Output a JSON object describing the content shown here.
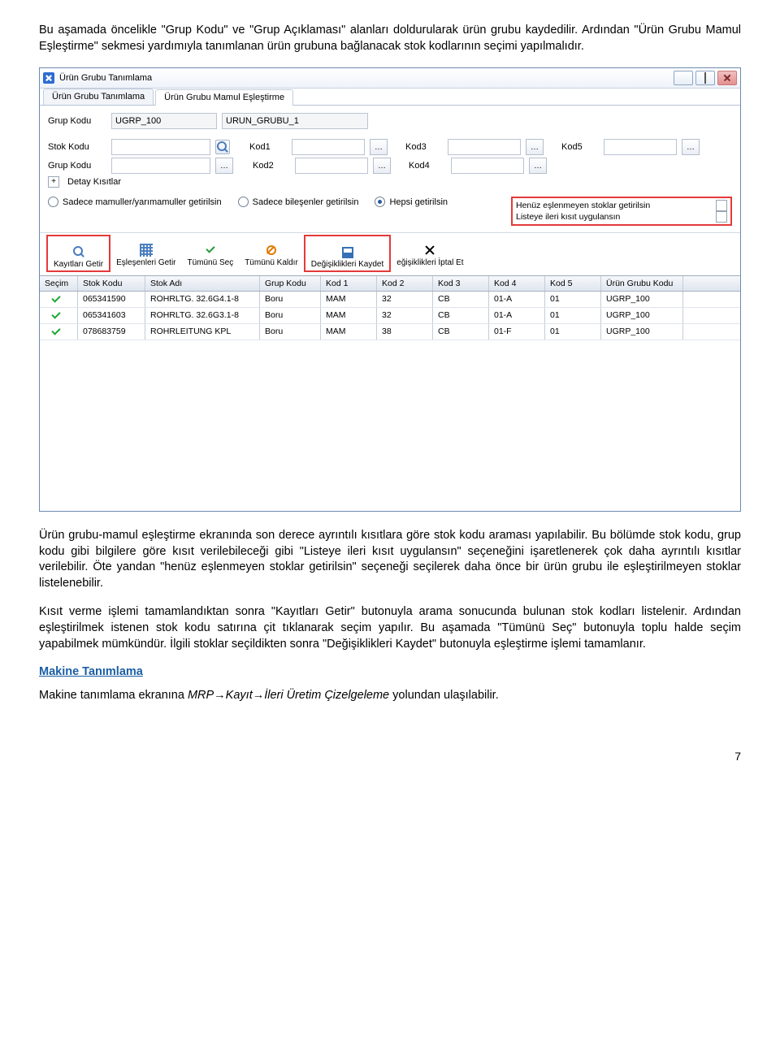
{
  "intro_paragraph": "Bu aşamada öncelikle \"Grup Kodu\" ve \"Grup Açıklaması\" alanları doldurularak ürün grubu kaydedilir. Ardından \"Ürün Grubu Mamul Eşleştirme\" sekmesi yardımıyla tanımlanan ürün grubuna bağlanacak stok kodlarının seçimi yapılmalıdır.",
  "window": {
    "title": "Ürün Grubu Tanımlama",
    "tabs": [
      "Ürün Grubu Tanımlama",
      "Ürün Grubu Mamul Eşleştirme"
    ],
    "fields": {
      "grup_kodu_label": "Grup Kodu",
      "grup_kodu_val": "UGRP_100",
      "grup_kodu_val2": "URUN_GRUBU_1",
      "stok_kodu_label": "Stok Kodu",
      "grup_kodu2_label": "Grup Kodu",
      "kod1": "Kod1",
      "kod2": "Kod2",
      "kod3": "Kod3",
      "kod4": "Kod4",
      "kod5": "Kod5",
      "detay": "Detay Kısıtlar"
    },
    "radios": [
      "Sadece mamuller/yarımamuller getirilsin",
      "Sadece bileşenler getirilsin",
      "Hepsi getirilsin"
    ],
    "checks": [
      "Henüz eşlenmeyen stoklar getirilsin",
      "Listeye ileri kısıt uygulansın"
    ],
    "toolbar": [
      "Kayıtları Getir",
      "Eşleşenleri Getir",
      "Tümünü Seç",
      "Tümünü Kaldır",
      "Değişiklikleri Kaydet",
      "eğişiklikleri İptal Et"
    ],
    "columns": [
      "Seçim",
      "Stok Kodu",
      "Stok Adı",
      "Grup Kodu",
      "Kod 1",
      "Kod 2",
      "Kod 3",
      "Kod 4",
      "Kod 5",
      "Ürün Grubu Kodu"
    ],
    "rows": [
      {
        "sk": "065341590",
        "sa": "ROHRLTG. 32.6G4.1-8",
        "gk": "Boru",
        "k1": "MAM",
        "k2": "32",
        "k3": "CB",
        "k4": "01-A",
        "k5": "01",
        "ug": "UGRP_100"
      },
      {
        "sk": "065341603",
        "sa": "ROHRLTG. 32.6G3.1-8",
        "gk": "Boru",
        "k1": "MAM",
        "k2": "32",
        "k3": "CB",
        "k4": "01-A",
        "k5": "01",
        "ug": "UGRP_100"
      },
      {
        "sk": "078683759",
        "sa": "ROHRLEITUNG KPL",
        "gk": "Boru",
        "k1": "MAM",
        "k2": "38",
        "k3": "CB",
        "k4": "01-F",
        "k5": "01",
        "ug": "UGRP_100"
      }
    ]
  },
  "para2": "Ürün grubu-mamul eşleştirme ekranında son derece ayrıntılı kısıtlara göre stok kodu araması yapılabilir. Bu bölümde stok kodu, grup kodu gibi bilgilere göre kısıt verilebileceği gibi \"Listeye ileri kısıt uygulansın\" seçeneğini işaretlenerek çok daha ayrıntılı kısıtlar verilebilir. Öte yandan \"henüz eşlenmeyen stoklar getirilsin\" seçeneği seçilerek daha önce bir ürün grubu ile eşleştirilmeyen stoklar listelenebilir.",
  "para3": "Kısıt verme işlemi tamamlandıktan sonra \"Kayıtları Getir\" butonuyla arama sonucunda bulunan stok kodları listelenir. Ardından eşleştirilmek istenen stok kodu satırına çit tıklanarak seçim yapılır. Bu aşamada \"Tümünü Seç\" butonuyla toplu halde seçim yapabilmek mümkündür. İlgili stoklar seçildikten sonra \"Değişiklikleri Kaydet\" butonuyla eşleştirme işlemi tamamlanır.",
  "heading": "Makine Tanımlama",
  "para4_pre": "Makine tanımlama ekranına ",
  "para4_it": "MRP→Kayıt→İleri Üretim Çizelgeleme",
  "para4_post": " yolundan ulaşılabilir.",
  "page_num": "7"
}
